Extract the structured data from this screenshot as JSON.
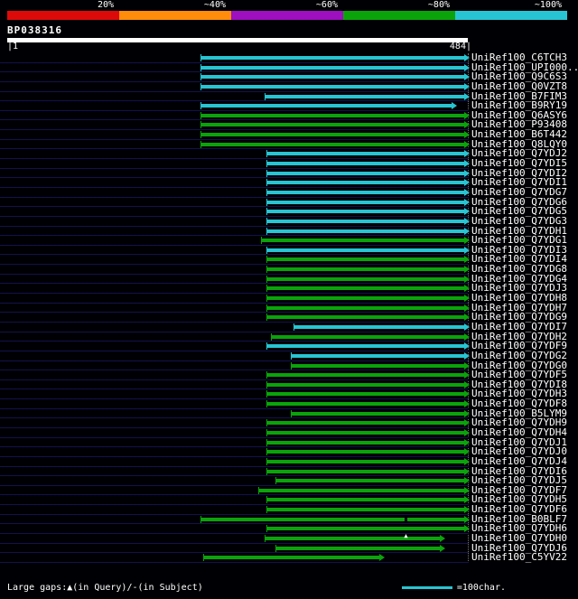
{
  "header": {
    "query_name": "BP038316",
    "coord_start_label": "|1",
    "coord_end_label": "484|"
  },
  "identity_key": [
    {
      "label": "20%",
      "color": "#dd0a0a"
    },
    {
      "label": "~40%",
      "color": "#ff8c0a"
    },
    {
      "label": "~60%",
      "color": "#9d0fbf"
    },
    {
      "label": "~80%",
      "color": "#0aa40a"
    },
    {
      "label": "~100%",
      "color": "#27c5d3"
    }
  ],
  "footer": {
    "gaps_label": "Large gaps:▲(in Query)/-(in Subject)",
    "scale_label": "=100char."
  },
  "colors": {
    "background": "#000004",
    "bar_cyan": "#27c5d3",
    "bar_green": "#0aa40a",
    "row_divider": "#12124d",
    "query_bar": "#ffffff"
  },
  "chart_data": {
    "type": "alignment-map",
    "query_name": "BP038316",
    "query_length": 484,
    "x_axis": {
      "start": 1,
      "end": 484
    },
    "identity_scale": [
      "20%",
      "~40%",
      "~60%",
      "~80%",
      "~100%"
    ],
    "legend": "color encodes % identity; cyan ≈100%, green ≈80%",
    "rows": [
      {
        "label": "UniRef100_C6TCH3",
        "color": "cyan",
        "start": 203,
        "end": 480
      },
      {
        "label": "UniRef100_UPI000..",
        "color": "cyan",
        "start": 203,
        "end": 480
      },
      {
        "label": "UniRef100_Q9C6S3",
        "color": "cyan",
        "start": 203,
        "end": 480
      },
      {
        "label": "UniRef100_Q0VZT8",
        "color": "cyan",
        "start": 203,
        "end": 480
      },
      {
        "label": "UniRef100_B7FIM3",
        "color": "cyan",
        "start": 270,
        "end": 480
      },
      {
        "label": "UniRef100_B9RY19",
        "color": "cyan",
        "start": 203,
        "end": 467
      },
      {
        "label": "UniRef100_Q6ASY6",
        "color": "green",
        "start": 203,
        "end": 480
      },
      {
        "label": "UniRef100_P93408",
        "color": "green",
        "start": 203,
        "end": 480
      },
      {
        "label": "UniRef100_B6T442",
        "color": "green",
        "start": 203,
        "end": 480
      },
      {
        "label": "UniRef100_Q8LQY0",
        "color": "green",
        "start": 203,
        "end": 480
      },
      {
        "label": "UniRef100_Q7YDJ2",
        "color": "cyan",
        "start": 272,
        "end": 480
      },
      {
        "label": "UniRef100_Q7YDI5",
        "color": "cyan",
        "start": 272,
        "end": 480
      },
      {
        "label": "UniRef100_Q7YDI2",
        "color": "cyan",
        "start": 272,
        "end": 480
      },
      {
        "label": "UniRef100_Q7YDI1",
        "color": "cyan",
        "start": 272,
        "end": 480
      },
      {
        "label": "UniRef100_Q7YDG7",
        "color": "cyan",
        "start": 272,
        "end": 480
      },
      {
        "label": "UniRef100_Q7YDG6",
        "color": "cyan",
        "start": 272,
        "end": 480
      },
      {
        "label": "UniRef100_Q7YDG5",
        "color": "cyan",
        "start": 272,
        "end": 480
      },
      {
        "label": "UniRef100_Q7YDG3",
        "color": "cyan",
        "start": 272,
        "end": 480
      },
      {
        "label": "UniRef100_Q7YDH1",
        "color": "cyan",
        "start": 272,
        "end": 480
      },
      {
        "label": "UniRef100_Q7YDG1",
        "color": "green",
        "start": 267,
        "end": 480
      },
      {
        "label": "UniRef100_Q7YDI3",
        "color": "cyan",
        "start": 272,
        "end": 480
      },
      {
        "label": "UniRef100_Q7YDI4",
        "color": "green",
        "start": 272,
        "end": 480
      },
      {
        "label": "UniRef100_Q7YDG8",
        "color": "green",
        "start": 272,
        "end": 480
      },
      {
        "label": "UniRef100_Q7YDG4",
        "color": "green",
        "start": 272,
        "end": 480
      },
      {
        "label": "UniRef100_Q7YDJ3",
        "color": "green",
        "start": 272,
        "end": 480
      },
      {
        "label": "UniRef100_Q7YDH8",
        "color": "green",
        "start": 272,
        "end": 480
      },
      {
        "label": "UniRef100_Q7YDH7",
        "color": "green",
        "start": 272,
        "end": 480
      },
      {
        "label": "UniRef100_Q7YDG9",
        "color": "green",
        "start": 272,
        "end": 480
      },
      {
        "label": "UniRef100_Q7YDI7",
        "color": "cyan",
        "start": 301,
        "end": 480
      },
      {
        "label": "UniRef100_Q7YDH2",
        "color": "green",
        "start": 277,
        "end": 480
      },
      {
        "label": "UniRef100_Q7YDF9",
        "color": "cyan",
        "start": 272,
        "end": 480
      },
      {
        "label": "UniRef100_Q7YDG2",
        "color": "cyan",
        "start": 298,
        "end": 480
      },
      {
        "label": "UniRef100_Q7YDG0",
        "color": "green",
        "start": 298,
        "end": 480
      },
      {
        "label": "UniRef100_Q7YDF5",
        "color": "green",
        "start": 272,
        "end": 480
      },
      {
        "label": "UniRef100_Q7YDI8",
        "color": "green",
        "start": 272,
        "end": 480
      },
      {
        "label": "UniRef100_Q7YDH3",
        "color": "green",
        "start": 272,
        "end": 480
      },
      {
        "label": "UniRef100_Q7YDF8",
        "color": "green",
        "start": 272,
        "end": 480
      },
      {
        "label": "UniRef100_B5LYM9",
        "color": "green",
        "start": 298,
        "end": 480
      },
      {
        "label": "UniRef100_Q7YDH9",
        "color": "green",
        "start": 272,
        "end": 480
      },
      {
        "label": "UniRef100_Q7YDH4",
        "color": "green",
        "start": 272,
        "end": 480
      },
      {
        "label": "UniRef100_Q7YDJ1",
        "color": "green",
        "start": 272,
        "end": 480
      },
      {
        "label": "UniRef100_Q7YDJ0",
        "color": "green",
        "start": 272,
        "end": 480
      },
      {
        "label": "UniRef100_Q7YDJ4",
        "color": "green",
        "start": 272,
        "end": 480
      },
      {
        "label": "UniRef100_Q7YDI6",
        "color": "green",
        "start": 272,
        "end": 480
      },
      {
        "label": "UniRef100_Q7YDJ5",
        "color": "green",
        "start": 282,
        "end": 480
      },
      {
        "label": "UniRef100_Q7YDF7",
        "color": "green",
        "start": 264,
        "end": 480
      },
      {
        "label": "UniRef100_Q7YDH5",
        "color": "green",
        "start": 272,
        "end": 480
      },
      {
        "label": "UniRef100_Q7YDF6",
        "color": "green",
        "start": 272,
        "end": 480
      },
      {
        "label": "UniRef100_B0BLF7",
        "color": "green",
        "start": 203,
        "end": 480,
        "marker": {
          "pos": 418,
          "type": "subject-gap"
        }
      },
      {
        "label": "UniRef100_Q7YDH6",
        "color": "green",
        "start": 272,
        "end": 480
      },
      {
        "label": "UniRef100_Q7YDH0",
        "color": "green",
        "start": 270,
        "end": 455,
        "marker": {
          "pos": 417,
          "type": "query-gap"
        }
      },
      {
        "label": "UniRef100_Q7YDJ6",
        "color": "green",
        "start": 282,
        "end": 455
      },
      {
        "label": "UniRef100_C5YV22",
        "color": "green",
        "start": 206,
        "end": 391
      }
    ]
  }
}
